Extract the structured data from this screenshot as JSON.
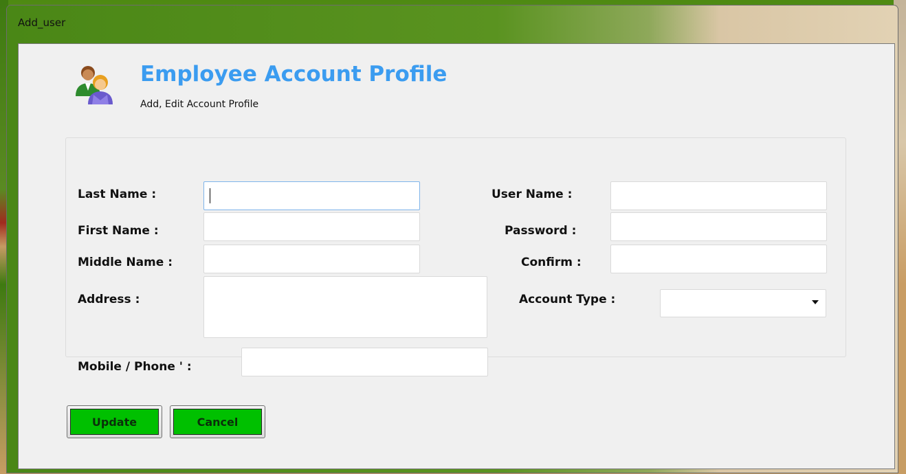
{
  "window": {
    "title": "Add_user"
  },
  "header": {
    "icon": "users-icon",
    "title": "Employee Account Profile",
    "subtitle": "Add, Edit Account Profile"
  },
  "form": {
    "last_name": {
      "label": "Last Name :",
      "value": ""
    },
    "first_name": {
      "label": "First Name :",
      "value": ""
    },
    "middle_name": {
      "label": "Middle Name :",
      "value": ""
    },
    "address": {
      "label": "Address :",
      "value": ""
    },
    "mobile": {
      "label": "Mobile / Phone ' :",
      "value": ""
    },
    "user_name": {
      "label": "User Name :",
      "value": ""
    },
    "password": {
      "label": "Password :",
      "value": ""
    },
    "confirm": {
      "label": "Confirm :",
      "value": ""
    },
    "account_type": {
      "label": "Account Type :",
      "value": ""
    }
  },
  "buttons": {
    "update": "Update",
    "cancel": "Cancel"
  },
  "colors": {
    "title_blue": "#3b9cf0",
    "button_green": "#00c000"
  }
}
